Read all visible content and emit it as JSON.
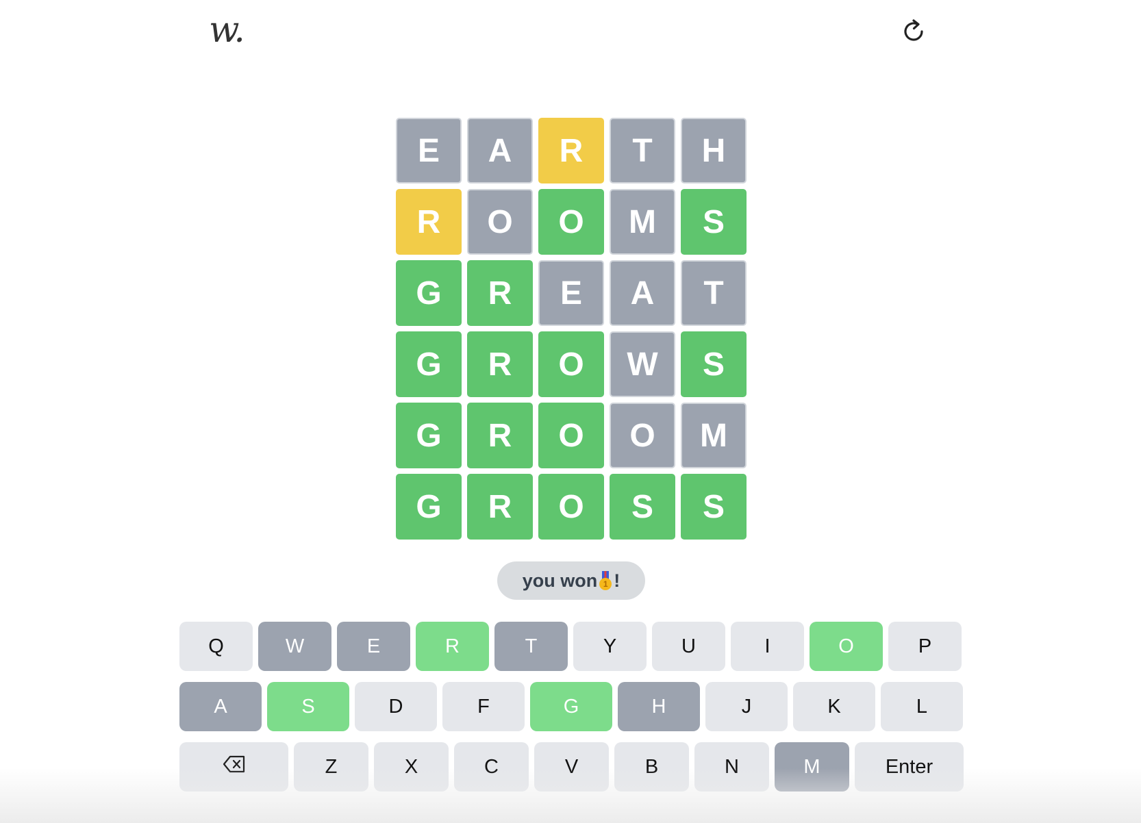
{
  "header": {
    "logo_text": "w.",
    "reload_icon": "reload-icon"
  },
  "board": {
    "rows": [
      {
        "word": "EARTH",
        "tiles": [
          {
            "letter": "E",
            "state": "absent"
          },
          {
            "letter": "A",
            "state": "absent"
          },
          {
            "letter": "R",
            "state": "present"
          },
          {
            "letter": "T",
            "state": "absent"
          },
          {
            "letter": "H",
            "state": "absent"
          }
        ]
      },
      {
        "word": "ROOMS",
        "tiles": [
          {
            "letter": "R",
            "state": "present"
          },
          {
            "letter": "O",
            "state": "absent"
          },
          {
            "letter": "O",
            "state": "correct"
          },
          {
            "letter": "M",
            "state": "absent"
          },
          {
            "letter": "S",
            "state": "correct"
          }
        ]
      },
      {
        "word": "GREAT",
        "tiles": [
          {
            "letter": "G",
            "state": "correct"
          },
          {
            "letter": "R",
            "state": "correct"
          },
          {
            "letter": "E",
            "state": "absent"
          },
          {
            "letter": "A",
            "state": "absent"
          },
          {
            "letter": "T",
            "state": "absent"
          }
        ]
      },
      {
        "word": "GROWS",
        "tiles": [
          {
            "letter": "G",
            "state": "correct"
          },
          {
            "letter": "R",
            "state": "correct"
          },
          {
            "letter": "O",
            "state": "correct"
          },
          {
            "letter": "W",
            "state": "absent"
          },
          {
            "letter": "S",
            "state": "correct"
          }
        ]
      },
      {
        "word": "GROOM",
        "tiles": [
          {
            "letter": "G",
            "state": "correct"
          },
          {
            "letter": "R",
            "state": "correct"
          },
          {
            "letter": "O",
            "state": "correct"
          },
          {
            "letter": "O",
            "state": "absent"
          },
          {
            "letter": "M",
            "state": "absent"
          }
        ]
      },
      {
        "word": "GROSS",
        "tiles": [
          {
            "letter": "G",
            "state": "correct"
          },
          {
            "letter": "R",
            "state": "correct"
          },
          {
            "letter": "O",
            "state": "correct"
          },
          {
            "letter": "S",
            "state": "correct"
          },
          {
            "letter": "S",
            "state": "correct"
          }
        ]
      }
    ]
  },
  "toast": {
    "text_before": "you won",
    "medal_icon": "gold-medal-icon",
    "medal_digit": "1",
    "text_after": "!"
  },
  "keyboard": {
    "row1": [
      {
        "label": "Q",
        "state": "unused"
      },
      {
        "label": "W",
        "state": "absent"
      },
      {
        "label": "E",
        "state": "absent"
      },
      {
        "label": "R",
        "state": "correct"
      },
      {
        "label": "T",
        "state": "absent"
      },
      {
        "label": "Y",
        "state": "unused"
      },
      {
        "label": "U",
        "state": "unused"
      },
      {
        "label": "I",
        "state": "unused"
      },
      {
        "label": "O",
        "state": "correct"
      },
      {
        "label": "P",
        "state": "unused"
      }
    ],
    "row2": [
      {
        "label": "A",
        "state": "absent"
      },
      {
        "label": "S",
        "state": "correct"
      },
      {
        "label": "D",
        "state": "unused"
      },
      {
        "label": "F",
        "state": "unused"
      },
      {
        "label": "G",
        "state": "correct"
      },
      {
        "label": "H",
        "state": "absent"
      },
      {
        "label": "J",
        "state": "unused"
      },
      {
        "label": "K",
        "state": "unused"
      },
      {
        "label": "L",
        "state": "unused"
      }
    ],
    "row3": [
      {
        "label": "",
        "icon": "backspace-icon",
        "state": "unused"
      },
      {
        "label": "Z",
        "state": "unused"
      },
      {
        "label": "X",
        "state": "unused"
      },
      {
        "label": "C",
        "state": "unused"
      },
      {
        "label": "V",
        "state": "unused"
      },
      {
        "label": "B",
        "state": "unused"
      },
      {
        "label": "N",
        "state": "unused"
      },
      {
        "label": "M",
        "state": "absent"
      },
      {
        "label": "Enter",
        "state": "unused"
      }
    ]
  },
  "colors": {
    "absent": "#9ca3af",
    "present": "#f2cc48",
    "correct": "#5fc56e",
    "key_correct": "#7ddc8b",
    "key_unused": "#e5e7eb"
  }
}
